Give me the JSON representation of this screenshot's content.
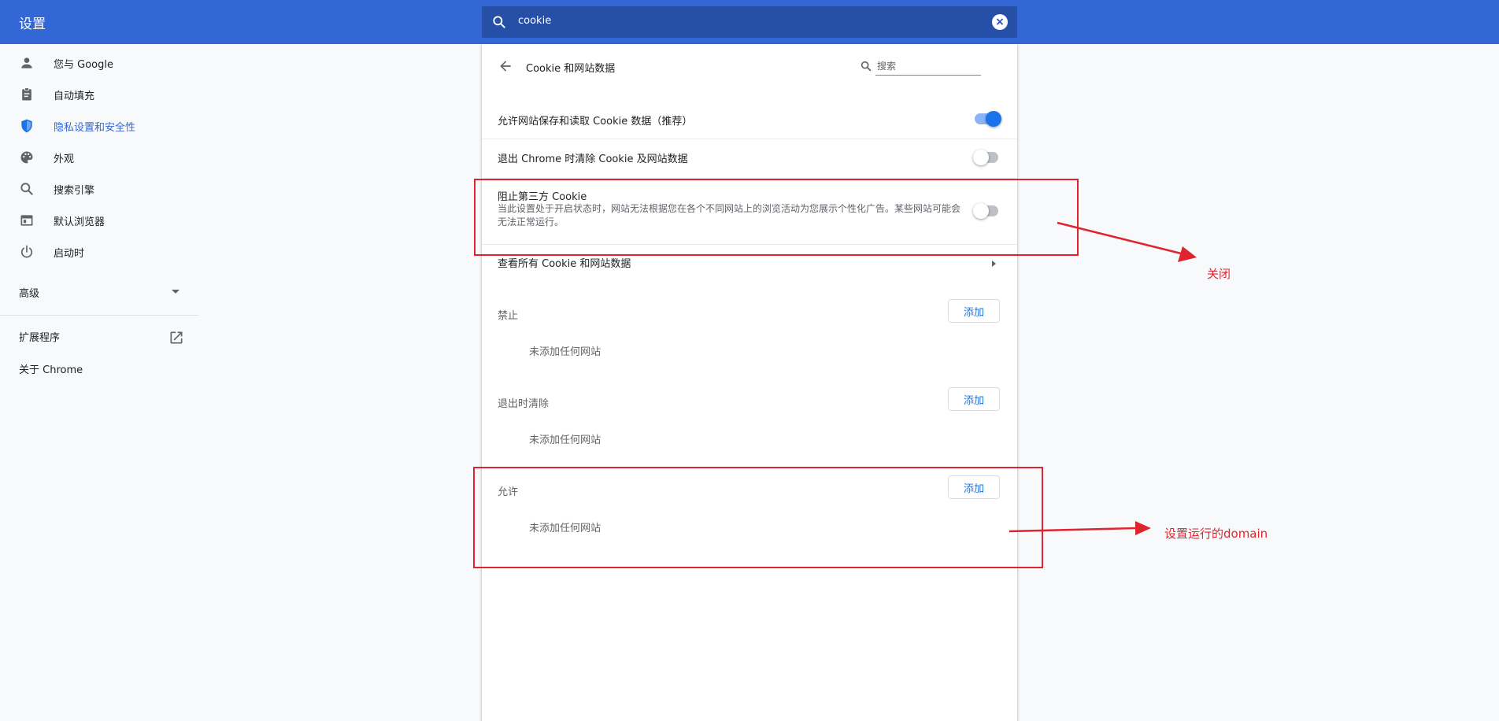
{
  "header": {
    "title": "设置",
    "search_value": "cookie"
  },
  "sidebar": {
    "items": [
      {
        "label": "您与 Google",
        "icon": "person-icon"
      },
      {
        "label": "自动填充",
        "icon": "clipboard-icon"
      },
      {
        "label": "隐私设置和安全性",
        "icon": "shield-icon",
        "active": true
      },
      {
        "label": "外观",
        "icon": "palette-icon"
      },
      {
        "label": "搜索引擎",
        "icon": "search-icon"
      },
      {
        "label": "默认浏览器",
        "icon": "browser-icon"
      },
      {
        "label": "启动时",
        "icon": "power-icon"
      }
    ],
    "advanced": "高级",
    "extensions": "扩展程序",
    "about": "关于 Chrome"
  },
  "page": {
    "title": "Cookie 和网站数据",
    "search_placeholder": "搜索",
    "settings": [
      {
        "label": "允许网站保存和读取 Cookie 数据（推荐）",
        "enabled": true
      },
      {
        "label": "退出 Chrome 时清除 Cookie 及网站数据",
        "enabled": false
      },
      {
        "label": "阻止第三方 Cookie",
        "description": "当此设置处于开启状态时，网站无法根据您在各个不同网站上的浏览活动为您展示个性化广告。某些网站可能会无法正常运行。",
        "enabled": false
      }
    ],
    "see_all": "查看所有 Cookie 和网站数据",
    "sections": [
      {
        "label": "禁止",
        "button": "添加",
        "empty": "未添加任何网站"
      },
      {
        "label": "退出时清除",
        "button": "添加",
        "empty": "未添加任何网站"
      },
      {
        "label": "允许",
        "button": "添加",
        "empty": "未添加任何网站"
      }
    ]
  },
  "annotations": {
    "close_note": "关闭",
    "allow_note": "设置运行的domain",
    "color": "#e0242f"
  },
  "colors": {
    "header": "#3367d6",
    "accent": "#1a73e8"
  }
}
